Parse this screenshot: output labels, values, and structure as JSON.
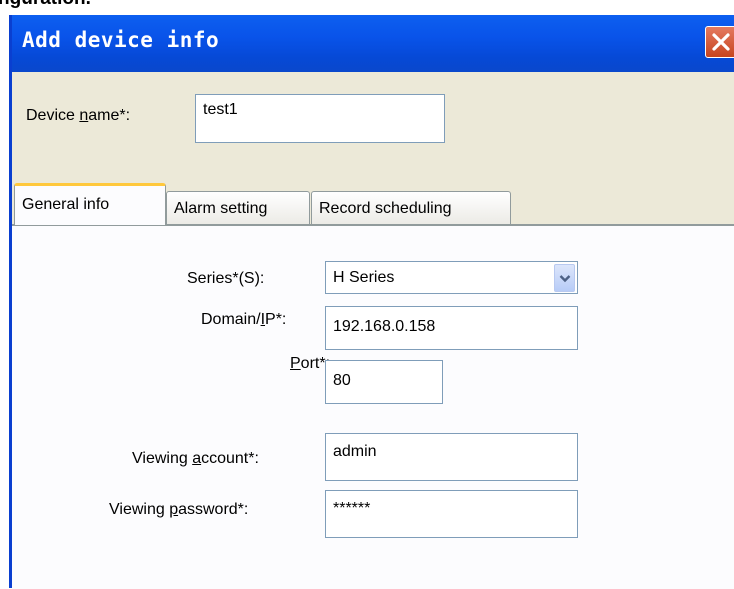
{
  "heading": "nguration.",
  "dialog": {
    "title": "Add device info",
    "close_icon": "close-x-icon"
  },
  "device_name": {
    "label_pre": "Device ",
    "label_key": "n",
    "label_post": "ame*:",
    "value": "test1"
  },
  "tabs": [
    {
      "label": "General info",
      "active": true
    },
    {
      "label": "Alarm setting",
      "active": false
    },
    {
      "label": "Record scheduling",
      "active": false
    }
  ],
  "general": {
    "series": {
      "label": "Series*(S):",
      "value": "H Series",
      "arrow_icon": "chevron-down-icon"
    },
    "domain": {
      "label_pre": "Domain/",
      "label_key": "I",
      "label_post": "P*:",
      "value": "192.168.0.158"
    },
    "port": {
      "label_key": "P",
      "label_post": "ort*:",
      "value": "80"
    },
    "account": {
      "label_pre": "Viewing ",
      "label_key": "a",
      "label_post": "ccount*:",
      "value": "admin"
    },
    "password": {
      "label_pre": "Viewing ",
      "label_key": "p",
      "label_post": "assword*:",
      "value": "******"
    }
  }
}
